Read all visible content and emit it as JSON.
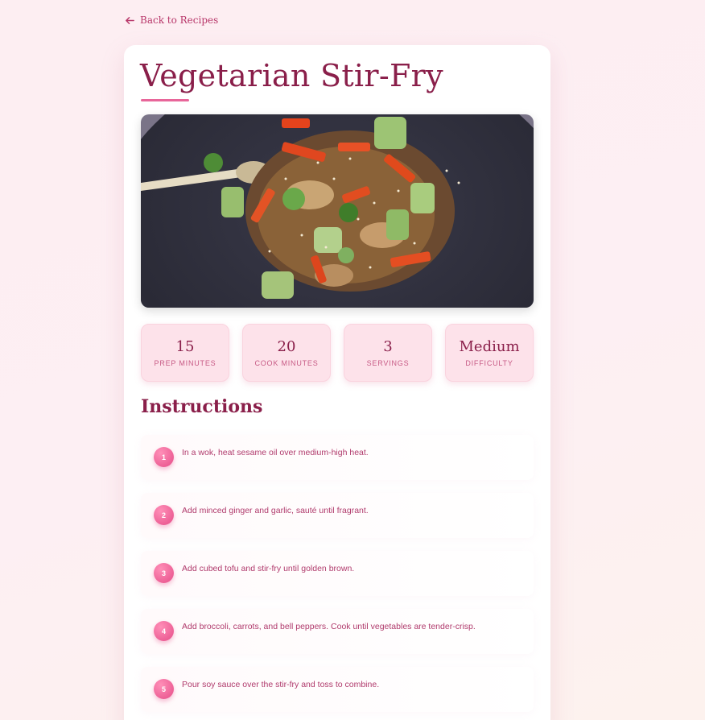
{
  "nav": {
    "back_label": "Back to Recipes"
  },
  "recipe": {
    "title": "Vegetarian Stir-Fry",
    "image_alt": "Vegetarian stir-fry in a dark wok",
    "stats": [
      {
        "value": "15",
        "label": "Prep Minutes"
      },
      {
        "value": "20",
        "label": "Cook Minutes"
      },
      {
        "value": "3",
        "label": "Servings"
      },
      {
        "value": "Medium",
        "label": "Difficulty"
      }
    ],
    "instructions_title": "Instructions",
    "steps": [
      {
        "number": "1",
        "text": "In a wok, heat sesame oil over medium-high heat."
      },
      {
        "number": "2",
        "text": "Add minced ginger and garlic, sauté until fragrant."
      },
      {
        "number": "3",
        "text": "Add cubed tofu and stir-fry until golden brown."
      },
      {
        "number": "4",
        "text": "Add broccoli, carrots, and bell peppers. Cook until vegetables are tender-crisp."
      },
      {
        "number": "5",
        "text": "Pour soy sauce over the stir-fry and toss to combine."
      }
    ]
  },
  "colors": {
    "accent": "#e8669a",
    "title": "#8a1f4a",
    "stat_bg": "#fde2ea"
  }
}
